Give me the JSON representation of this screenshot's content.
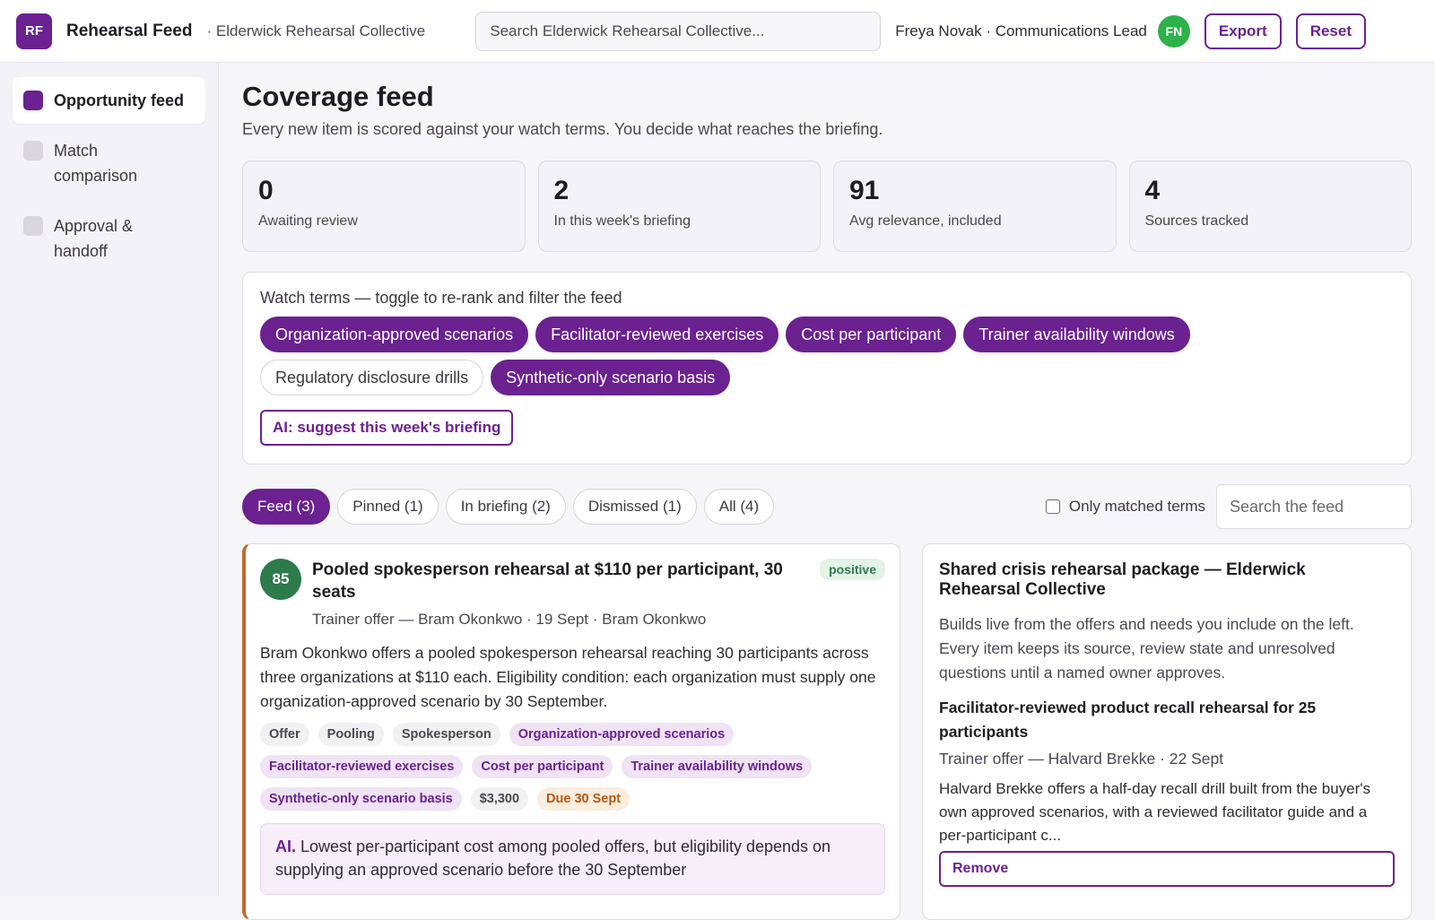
{
  "topbar": {
    "logo": "RF",
    "app_title": "Rehearsal Feed",
    "org_name": "· Elderwick Rehearsal Collective",
    "search_placeholder": "Search Elderwick Rehearsal Collective...",
    "user_label": "Freya Novak · Communications Lead",
    "avatar_initials": "FN",
    "export_label": "Export",
    "reset_label": "Reset"
  },
  "sidebar": {
    "items": [
      {
        "label": "Opportunity feed",
        "active": true
      },
      {
        "label": "Match comparison",
        "active": false
      },
      {
        "label": "Approval & handoff",
        "active": false
      }
    ]
  },
  "main": {
    "title": "Coverage feed",
    "subtitle": "Every new item is scored against your watch terms. You decide what reaches the briefing.",
    "stats": [
      {
        "value": "0",
        "label": "Awaiting review"
      },
      {
        "value": "2",
        "label": "In this week's briefing"
      },
      {
        "value": "91",
        "label": "Avg relevance, included"
      },
      {
        "value": "4",
        "label": "Sources tracked"
      }
    ]
  },
  "watch_terms": {
    "title": "Watch terms — toggle to re-rank and filter the feed",
    "chips": [
      {
        "label": "Organization-approved scenarios",
        "on": true
      },
      {
        "label": "Facilitator-reviewed exercises",
        "on": true
      },
      {
        "label": "Cost per participant",
        "on": true
      },
      {
        "label": "Trainer availability windows",
        "on": true
      },
      {
        "label": "Regulatory disclosure drills",
        "on": false
      },
      {
        "label": "Synthetic-only scenario basis",
        "on": true
      }
    ],
    "ai_button": "AI: suggest this week's briefing"
  },
  "filters": {
    "tabs": [
      {
        "label": "Feed (3)",
        "active": true
      },
      {
        "label": "Pinned (1)",
        "active": false
      },
      {
        "label": "In briefing (2)",
        "active": false
      },
      {
        "label": "Dismissed (1)",
        "active": false
      },
      {
        "label": "All (4)",
        "active": false
      }
    ],
    "only_matched_label": "Only matched terms",
    "search_placeholder": "Search the feed"
  },
  "feed_item": {
    "score": "85",
    "title": "Pooled spokesperson rehearsal at $110 per participant, 30 seats",
    "sentiment": "positive",
    "meta": "Trainer offer — Bram Okonkwo · 19 Sept · Bram Okonkwo",
    "body": "Bram Okonkwo offers a pooled spokesperson rehearsal reaching 30 participants across three organizations at $110 each. Eligibility condition: each organization must supply one organization-approved scenario by 30 September.",
    "tags": [
      {
        "label": "Offer",
        "kind": "plain"
      },
      {
        "label": "Pooling",
        "kind": "plain"
      },
      {
        "label": "Spokesperson",
        "kind": "plain"
      },
      {
        "label": "Organization-approved scenarios",
        "kind": "term"
      },
      {
        "label": "Facilitator-reviewed exercises",
        "kind": "term"
      },
      {
        "label": "Cost per participant",
        "kind": "term"
      },
      {
        "label": "Trainer availability windows",
        "kind": "term"
      },
      {
        "label": "Synthetic-only scenario basis",
        "kind": "term"
      },
      {
        "label": "$3,300",
        "kind": "plain"
      },
      {
        "label": "Due 30 Sept",
        "kind": "due"
      }
    ],
    "ai_label": "AI.",
    "ai_text": "Lowest per-participant cost among pooled offers, but eligibility depends on supplying an approved scenario before the 30 September"
  },
  "package": {
    "title": "Shared crisis rehearsal package — Elderwick Rehearsal Collective",
    "description": "Builds live from the offers and needs you include on the left. Every item keeps its source, review state and unresolved questions until a named owner approves.",
    "item_title": "Facilitator-reviewed product recall rehearsal for 25 participants",
    "item_meta": "Trainer offer — Halvard Brekke · 22 Sept",
    "item_body": "Halvard Brekke offers a half-day recall drill built from the buyer's own approved scenarios, with a reviewed facilitator guide and a per-participant c...",
    "remove_label": "Remove"
  }
}
